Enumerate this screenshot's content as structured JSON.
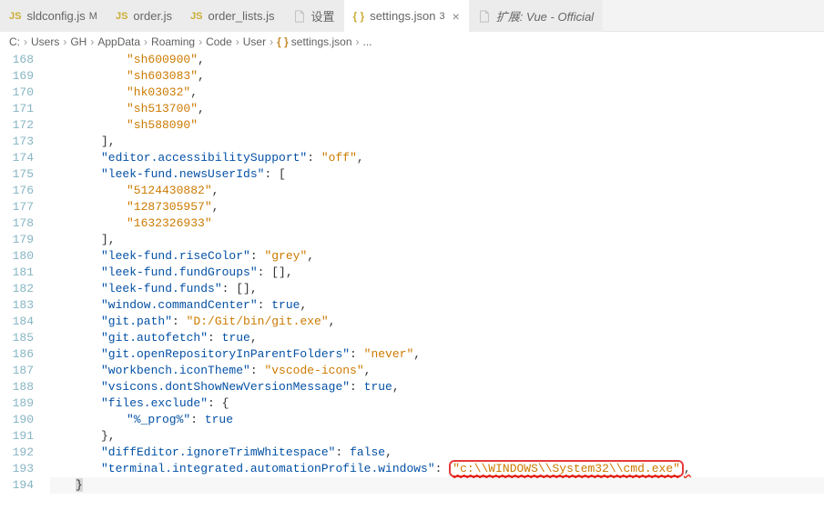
{
  "tabs": [
    {
      "icon": "JS",
      "label": "sldconfig.js",
      "modified": "M",
      "active": false
    },
    {
      "icon": "JS",
      "label": "order.js",
      "modified": "",
      "active": false
    },
    {
      "icon": "JS",
      "label": "order_lists.js",
      "modified": "",
      "active": false
    },
    {
      "icon": "file",
      "label": "设置",
      "modified": "",
      "active": false
    },
    {
      "icon": "{}",
      "label": "settings.json",
      "modified": "3",
      "active": true
    },
    {
      "icon": "file",
      "label": "扩展: Vue - Official",
      "modified": "",
      "active": false,
      "italic": true
    }
  ],
  "breadcrumb": [
    "C:",
    "Users",
    "GH",
    "AppData",
    "Roaming",
    "Code",
    "User",
    "settings.json",
    "..."
  ],
  "breadcrumb_icon_before": "settings.json",
  "lines_start": 168,
  "lines": [
    {
      "n": 168,
      "ind": 3,
      "parts": [
        [
          "s",
          "\"sh600900\""
        ],
        [
          "p",
          ","
        ]
      ]
    },
    {
      "n": 169,
      "ind": 3,
      "parts": [
        [
          "s",
          "\"sh603083\""
        ],
        [
          "p",
          ","
        ]
      ]
    },
    {
      "n": 170,
      "ind": 3,
      "parts": [
        [
          "s",
          "\"hk03032\""
        ],
        [
          "p",
          ","
        ]
      ]
    },
    {
      "n": 171,
      "ind": 3,
      "parts": [
        [
          "s",
          "\"sh513700\""
        ],
        [
          "p",
          ","
        ]
      ]
    },
    {
      "n": 172,
      "ind": 3,
      "parts": [
        [
          "s",
          "\"sh588090\""
        ]
      ]
    },
    {
      "n": 173,
      "ind": 2,
      "parts": [
        [
          "p",
          "],"
        ]
      ]
    },
    {
      "n": 174,
      "ind": 2,
      "parts": [
        [
          "k",
          "\"editor.accessibilitySupport\""
        ],
        [
          "p",
          ": "
        ],
        [
          "s",
          "\"off\""
        ],
        [
          "p",
          ","
        ]
      ]
    },
    {
      "n": 175,
      "ind": 2,
      "parts": [
        [
          "k",
          "\"leek-fund.newsUserIds\""
        ],
        [
          "p",
          ": ["
        ]
      ]
    },
    {
      "n": 176,
      "ind": 3,
      "parts": [
        [
          "s",
          "\"5124430882\""
        ],
        [
          "p",
          ","
        ]
      ]
    },
    {
      "n": 177,
      "ind": 3,
      "parts": [
        [
          "s",
          "\"1287305957\""
        ],
        [
          "p",
          ","
        ]
      ]
    },
    {
      "n": 178,
      "ind": 3,
      "parts": [
        [
          "s",
          "\"1632326933\""
        ]
      ]
    },
    {
      "n": 179,
      "ind": 2,
      "parts": [
        [
          "p",
          "],"
        ]
      ]
    },
    {
      "n": 180,
      "ind": 2,
      "parts": [
        [
          "k",
          "\"leek-fund.riseColor\""
        ],
        [
          "p",
          ": "
        ],
        [
          "s",
          "\"grey\""
        ],
        [
          "p",
          ","
        ]
      ]
    },
    {
      "n": 181,
      "ind": 2,
      "parts": [
        [
          "k",
          "\"leek-fund.fundGroups\""
        ],
        [
          "p",
          ": [],"
        ]
      ]
    },
    {
      "n": 182,
      "ind": 2,
      "parts": [
        [
          "k",
          "\"leek-fund.funds\""
        ],
        [
          "p",
          ": [],"
        ]
      ]
    },
    {
      "n": 183,
      "ind": 2,
      "parts": [
        [
          "k",
          "\"window.commandCenter\""
        ],
        [
          "p",
          ": "
        ],
        [
          "b",
          "true"
        ],
        [
          "p",
          ","
        ]
      ]
    },
    {
      "n": 184,
      "ind": 2,
      "parts": [
        [
          "k",
          "\"git.path\""
        ],
        [
          "p",
          ": "
        ],
        [
          "s",
          "\"D:/Git/bin/git.exe\""
        ],
        [
          "p",
          ","
        ]
      ]
    },
    {
      "n": 185,
      "ind": 2,
      "parts": [
        [
          "k",
          "\"git.autofetch\""
        ],
        [
          "p",
          ": "
        ],
        [
          "b",
          "true"
        ],
        [
          "p",
          ","
        ]
      ]
    },
    {
      "n": 186,
      "ind": 2,
      "parts": [
        [
          "k",
          "\"git.openRepositoryInParentFolders\""
        ],
        [
          "p",
          ": "
        ],
        [
          "s",
          "\"never\""
        ],
        [
          "p",
          ","
        ]
      ]
    },
    {
      "n": 187,
      "ind": 2,
      "parts": [
        [
          "k",
          "\"workbench.iconTheme\""
        ],
        [
          "p",
          ": "
        ],
        [
          "s",
          "\"vscode-icons\""
        ],
        [
          "p",
          ","
        ]
      ]
    },
    {
      "n": 188,
      "ind": 2,
      "parts": [
        [
          "k",
          "\"vsicons.dontShowNewVersionMessage\""
        ],
        [
          "p",
          ": "
        ],
        [
          "b",
          "true"
        ],
        [
          "p",
          ","
        ]
      ]
    },
    {
      "n": 189,
      "ind": 2,
      "parts": [
        [
          "k",
          "\"files.exclude\""
        ],
        [
          "p",
          ": {"
        ]
      ]
    },
    {
      "n": 190,
      "ind": 3,
      "parts": [
        [
          "k",
          "\"%_prog%\""
        ],
        [
          "p",
          ": "
        ],
        [
          "b",
          "true"
        ]
      ]
    },
    {
      "n": 191,
      "ind": 2,
      "parts": [
        [
          "p",
          "},"
        ]
      ]
    },
    {
      "n": 192,
      "ind": 2,
      "parts": [
        [
          "k",
          "\"diffEditor.ignoreTrimWhitespace\""
        ],
        [
          "p",
          ": "
        ],
        [
          "b",
          "false"
        ],
        [
          "p",
          ","
        ]
      ]
    },
    {
      "n": 193,
      "ind": 2,
      "parts": [
        [
          "k",
          "\"terminal.integrated.automationProfile.windows\""
        ],
        [
          "p",
          ": "
        ],
        [
          "hl-s",
          "\"c:\\\\WINDOWS\\\\System32\\\\cmd.exe\""
        ],
        [
          "p-err",
          ","
        ]
      ]
    },
    {
      "n": 194,
      "ind": 1,
      "parts": [
        [
          "p-cursor",
          "}"
        ]
      ]
    }
  ]
}
